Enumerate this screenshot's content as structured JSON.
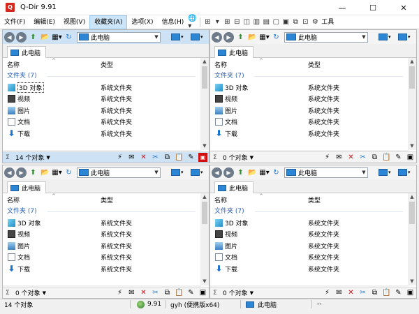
{
  "window": {
    "title": "Q-Dir 9.91",
    "app_icon_glyph": "Q",
    "minimize": "—",
    "maximize": "☐",
    "close": "✕"
  },
  "menu": {
    "items": [
      "文件(F)",
      "编辑(E)",
      "视图(V)",
      "收藏夹(A)",
      "选项(X)",
      "信息(H)"
    ],
    "active_index": 3,
    "right_label": "工具"
  },
  "panes": [
    {
      "address": "此电脑",
      "tab": "此电脑",
      "col_name": "名称",
      "col_type": "类型",
      "group": "文件夹 (7)",
      "rows": [
        {
          "name": "3D 对象",
          "type": "系统文件夹",
          "icon": "3d-objects-icon"
        },
        {
          "name": "视频",
          "type": "系统文件夹",
          "icon": "videos-icon"
        },
        {
          "name": "图片",
          "type": "系统文件夹",
          "icon": "pictures-icon"
        },
        {
          "name": "文档",
          "type": "系统文件夹",
          "icon": "documents-icon"
        },
        {
          "name": "下载",
          "type": "系统文件夹",
          "icon": "downloads-icon"
        }
      ],
      "status": "14 个对象"
    },
    {
      "address": "此电脑",
      "tab": "此电脑",
      "col_name": "名称",
      "col_type": "类型",
      "group": "文件夹 (7)",
      "rows": [
        {
          "name": "3D 对象",
          "type": "系统文件夹",
          "icon": "3d-objects-icon"
        },
        {
          "name": "视频",
          "type": "系统文件夹",
          "icon": "videos-icon"
        },
        {
          "name": "图片",
          "type": "系统文件夹",
          "icon": "pictures-icon"
        },
        {
          "name": "文档",
          "type": "系统文件夹",
          "icon": "documents-icon"
        },
        {
          "name": "下载",
          "type": "系统文件夹",
          "icon": "downloads-icon"
        }
      ],
      "status": "0 个对象"
    },
    {
      "address": "此电脑",
      "tab": "此电脑",
      "col_name": "名称",
      "col_type": "类型",
      "group": "文件夹 (7)",
      "rows": [
        {
          "name": "3D 对象",
          "type": "系统文件夹",
          "icon": "3d-objects-icon"
        },
        {
          "name": "视频",
          "type": "系统文件夹",
          "icon": "videos-icon"
        },
        {
          "name": "图片",
          "type": "系统文件夹",
          "icon": "pictures-icon"
        },
        {
          "name": "文档",
          "type": "系统文件夹",
          "icon": "documents-icon"
        },
        {
          "name": "下载",
          "type": "系统文件夹",
          "icon": "downloads-icon"
        }
      ],
      "status": "0 个对象"
    },
    {
      "address": "此电脑",
      "tab": "此电脑",
      "col_name": "名称",
      "col_type": "类型",
      "group": "文件夹 (7)",
      "rows": [
        {
          "name": "3D 对象",
          "type": "系统文件夹",
          "icon": "3d-objects-icon"
        },
        {
          "name": "视频",
          "type": "系统文件夹",
          "icon": "videos-icon"
        },
        {
          "name": "图片",
          "type": "系统文件夹",
          "icon": "pictures-icon"
        },
        {
          "name": "文档",
          "type": "系统文件夹",
          "icon": "documents-icon"
        },
        {
          "name": "下载",
          "type": "系统文件夹",
          "icon": "downloads-icon"
        }
      ],
      "status": "0 个对象"
    }
  ],
  "statusbar": {
    "objects": "14 个对象",
    "version": "9.91",
    "user": "gyh (便携版x64)",
    "location": "此电脑",
    "extra": "--"
  },
  "colors": {
    "accent": "#cde3f5",
    "pc_blue": "#2c86d6",
    "group_text": "#2a5db0",
    "close_red": "#d01010"
  }
}
